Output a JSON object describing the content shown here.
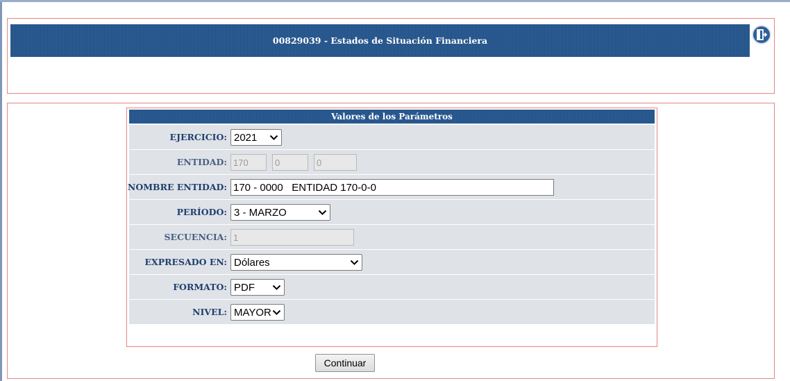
{
  "header": {
    "title": "00829039 - Estados de Situación Financiera",
    "exit_icon": "exit-door-icon"
  },
  "panel": {
    "title": "Valores de los Parámetros"
  },
  "fields": {
    "ejercicio": {
      "label": "EJERCICIO:",
      "value": "2021"
    },
    "entidad": {
      "label": "ENTIDAD:",
      "values": [
        "170",
        "0",
        "0"
      ]
    },
    "nombre_entidad": {
      "label": "NOMBRE ENTIDAD:",
      "value": "170 - 0000   ENTIDAD 170-0-0"
    },
    "periodo": {
      "label": "PERÍODO:",
      "value": "3 - MARZO"
    },
    "secuencia": {
      "label": "SECUENCIA:",
      "value": "1"
    },
    "expresado_en": {
      "label": "EXPRESADO EN:",
      "value": "Dólares"
    },
    "formato": {
      "label": "FORMATO:",
      "value": "PDF"
    },
    "nivel": {
      "label": "NIVEL:",
      "value": "MAYOR"
    }
  },
  "actions": {
    "continuar_label": "Continuar"
  },
  "colors": {
    "header_bg": "#225186",
    "row_bg": "#dfe2e7",
    "border_accent": "#e58585",
    "label_text": "#1f3f6f"
  }
}
